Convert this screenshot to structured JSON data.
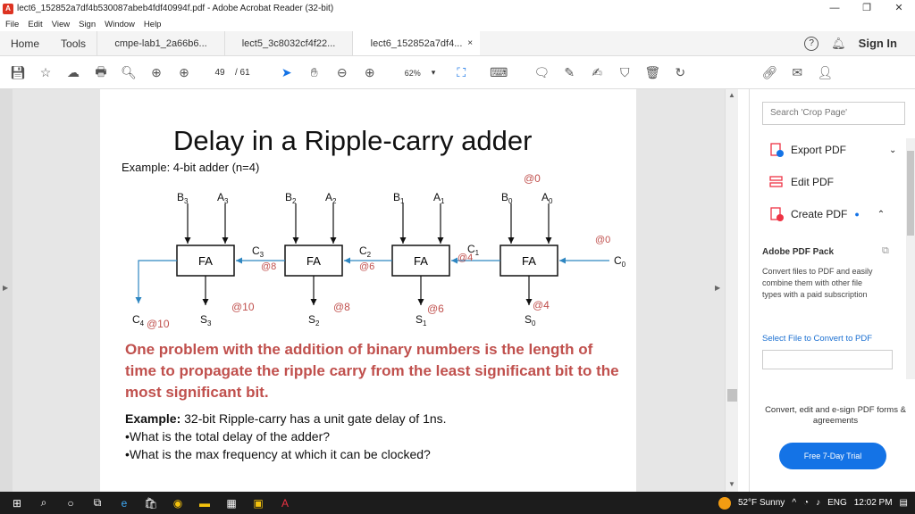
{
  "window": {
    "title": "lect6_152852a7df4b530087abeb4fdf40994f.pdf - Adobe Acrobat Reader (32-bit)"
  },
  "menu": [
    "File",
    "Edit",
    "View",
    "Sign",
    "Window",
    "Help"
  ],
  "tabs": {
    "home": "Home",
    "tools": "Tools",
    "docs": [
      "cmpe-lab1_2a66b6...",
      "lect5_3c8032cf4f22...",
      "lect6_152852a7df4..."
    ],
    "close": "×",
    "sign_in": "Sign In"
  },
  "toolbar": {
    "page_current": "49",
    "page_total": "/ 61",
    "zoom": "62%"
  },
  "slide": {
    "title": "Delay in  a Ripple-carry adder",
    "example": "Example: 4-bit adder (n=4)",
    "fa": "FA",
    "inputs": [
      {
        "b": "B",
        "b_sub": "3",
        "a": "A",
        "a_sub": "3"
      },
      {
        "b": "B",
        "b_sub": "2",
        "a": "A",
        "a_sub": "2"
      },
      {
        "b": "B",
        "b_sub": "1",
        "a": "A",
        "a_sub": "1"
      },
      {
        "b": "B",
        "b_sub": "0",
        "a": "A",
        "a_sub": "0"
      }
    ],
    "carries": [
      {
        "c": "C",
        "sub": "3",
        "t": "@8"
      },
      {
        "c": "C",
        "sub": "2",
        "t": "@6"
      },
      {
        "c": "C",
        "sub": "1",
        "t": "@4"
      }
    ],
    "c0": "C",
    "c0_sub": "0",
    "at0_top": "@0",
    "at0_right": "@0",
    "sums": [
      {
        "s": "S",
        "sub": "3",
        "t": "@10"
      },
      {
        "s": "S",
        "sub": "2",
        "t": "@8"
      },
      {
        "s": "S",
        "sub": "1",
        "t": "@6"
      },
      {
        "s": "S",
        "sub": "0",
        "t": "@4"
      }
    ],
    "c4": "C",
    "c4_sub": "4",
    "c4_t": "@10",
    "problem": "One problem with the addition of binary numbers is the length of time to propagate the ripple carry from the least significant bit to the most significant bit.",
    "example2_bold": "Example:",
    "example2_rest": " 32-bit Ripple-carry has a unit gate delay of 1ns.",
    "bullet1": "•What is the total delay of the adder?",
    "bullet2": "•What is the max frequency at which it can be clocked?"
  },
  "right_panel": {
    "search_placeholder": "Search 'Crop Page'",
    "export": "Export PDF",
    "edit": "Edit PDF",
    "create": "Create PDF",
    "pack_title": "Adobe PDF Pack",
    "pack_desc": "Convert files to PDF and easily combine them with other file types with a paid subscription",
    "select_file": "Select File to Convert to PDF",
    "promo": "Convert, edit and e-sign PDF forms & agreements",
    "trial": "Free 7-Day Trial"
  },
  "taskbar": {
    "weather": "52°F  Sunny",
    "lang": "ENG",
    "time": "12:02 PM"
  },
  "colors": {
    "accent": "#1473e6",
    "red_text": "#c0504d",
    "carry_line": "#2e86c1",
    "timing": "#c0504d"
  }
}
